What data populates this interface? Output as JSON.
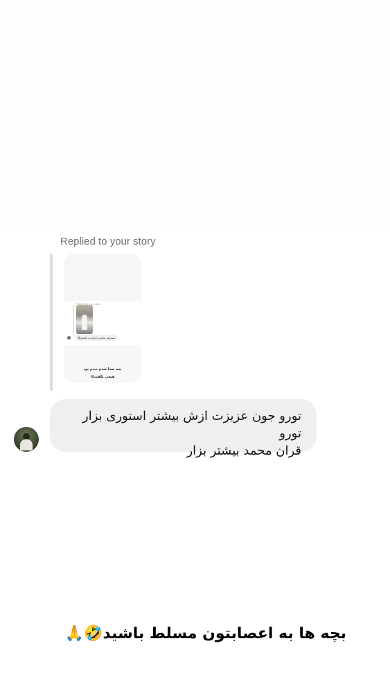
{
  "story_reply": {
    "label": "Replied to your story",
    "thumbnail": {
      "replied_label": "Replied to your story",
      "message": "نمیدونم بخندم یا ناراحت باشم😂",
      "caption_line1": "بچه صدا شدم دیدم بود",
      "caption_line2": "هیچی نگفت😅"
    }
  },
  "message": {
    "line1": "تورو جون عزیزت ازش بیشتر استوری بزار تورو",
    "line2": "قران محمد بیشتر بزار"
  },
  "overlay_caption": "بچه ها به اعصابتون مسلط باشید🤣🙏",
  "colors": {
    "bubble": "#efeff1",
    "label": "#6f6f72",
    "quote_bar": "#dcdcde"
  }
}
